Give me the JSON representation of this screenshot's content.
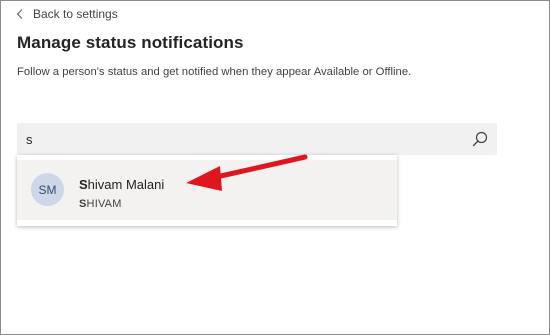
{
  "nav": {
    "back_label": "Back to settings",
    "back_icon": "chevron-left-icon"
  },
  "header": {
    "title": "Manage status notifications",
    "description": "Follow a person's status and get notified when they appear Available or Offline."
  },
  "search": {
    "value": "s",
    "icon": "search-icon"
  },
  "suggestions": [
    {
      "initials": "SM",
      "name_match": "S",
      "name_rest": "hivam Malani",
      "sub_match": "S",
      "sub_rest": "HIVAM"
    }
  ],
  "annotation": {
    "arrow_color": "#e0161f"
  },
  "colors": {
    "avatar_bg": "#cdd7e8",
    "search_bg": "#f0f0f0",
    "highlight_bg": "#f3f2f1"
  }
}
